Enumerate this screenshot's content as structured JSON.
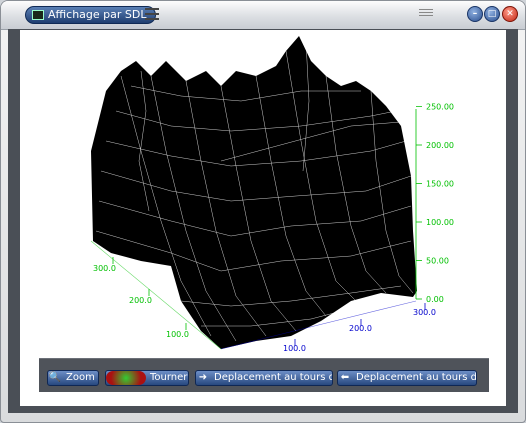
{
  "window": {
    "title": "Affichage par SDL"
  },
  "toolbar": {
    "zoom_label": "Zoom",
    "rotate_label": "Tourner",
    "move_z_label": "Deplacement au tours de Z",
    "move_x_label": "Deplacement au tours de X"
  },
  "colors": {
    "z_axis": "#00c000",
    "x_axis": "#0000cc",
    "surface": "#000000",
    "mesh": "#ffffff"
  },
  "chart_data": {
    "type": "surface",
    "z_ticks": [
      "0.00",
      "50.00",
      "100.00",
      "150.00",
      "200.00",
      "250.00"
    ],
    "x_ticks": [
      "100.0",
      "200.0",
      "300.0"
    ],
    "y_ticks": [
      "100.0",
      "200.0",
      "300.0"
    ]
  }
}
